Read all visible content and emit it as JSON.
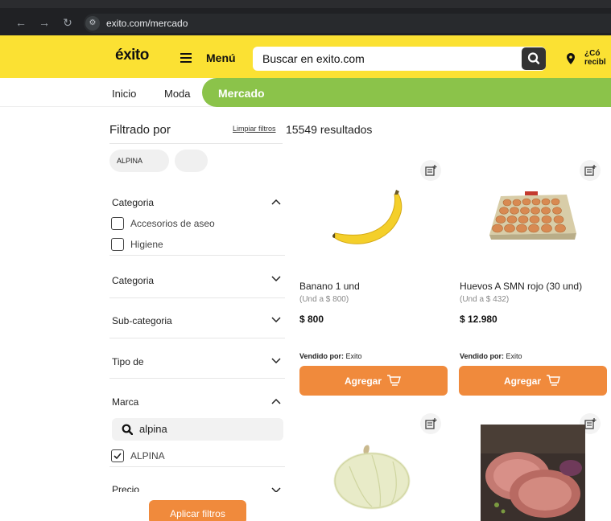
{
  "browser": {
    "url": "exito.com/mercado",
    "back_icon": "arrow-left-icon",
    "forward_icon": "arrow-right-icon",
    "reload_icon": "reload-icon",
    "site_info_icon": "tune-icon"
  },
  "header": {
    "logo": "éxito",
    "menu_label": "Menú",
    "search_placeholder": "Buscar en exito.com",
    "location_text": "¿Có\nrecibl",
    "location_line1": "¿Có",
    "location_line2": "recibl",
    "colors": {
      "header_bg": "#fbe133",
      "accent": "#8bc34a",
      "button": "#f08a3c"
    }
  },
  "categories": {
    "items": [
      "Inicio",
      "Moda"
    ],
    "active": "Mercado"
  },
  "filters": {
    "title": "Filtrado por",
    "clear_label": "Limpiar filtros",
    "results": "15549 resultados",
    "chips": [
      "ALPINA",
      ""
    ],
    "sections": [
      {
        "title": "Categoria",
        "expanded": true,
        "options": [
          {
            "label": "Accesorios de aseo",
            "checked": false
          },
          {
            "label": "Higiene",
            "checked": false
          }
        ]
      },
      {
        "title": "Categoria",
        "expanded": false
      },
      {
        "title": "Sub-categoria",
        "expanded": false
      },
      {
        "title": "Tipo de",
        "expanded": false
      },
      {
        "title": "Marca",
        "expanded": true,
        "search_value": "alpina",
        "options": [
          {
            "label": "ALPINA",
            "checked": true
          }
        ]
      },
      {
        "title": "Precio",
        "expanded": false
      }
    ],
    "apply_label": "Aplicar filtros"
  },
  "products": [
    {
      "name": "Banano 1 und",
      "unit_price": "(Und a $ 800)",
      "price": "$ 800",
      "seller_label": "Vendido por:",
      "seller": "Exito",
      "add_label": "Agregar",
      "image": "banana"
    },
    {
      "name": "Huevos A SMN rojo (30 und)",
      "unit_price": "(Und a $ 432)",
      "price": "$ 12.980",
      "seller_label": "Vendido por:",
      "seller": "Exito",
      "add_label": "Agregar",
      "image": "eggs-tray"
    },
    {
      "image": "onion"
    },
    {
      "image": "pork-meat"
    }
  ]
}
